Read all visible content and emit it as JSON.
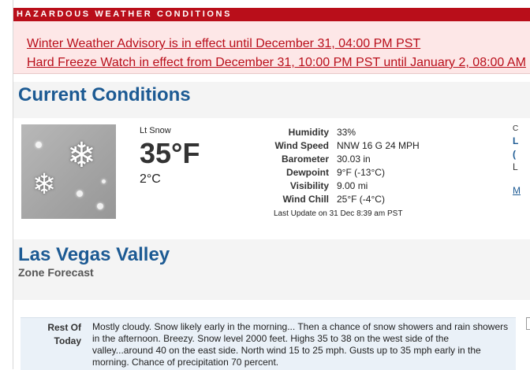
{
  "hazard": {
    "header": "HAZARDOUS WEATHER CONDITIONS",
    "items": [
      "Winter Weather Advisory is in effect until December 31, 04:00 PM PST",
      "Hard Freeze Watch in effect from December 31, 10:00 PM PST until January 2, 08:00 AM"
    ]
  },
  "current": {
    "title": "Current Conditions",
    "condition": "Lt Snow",
    "temp_f": "35°F",
    "temp_c": "2°C",
    "observations": [
      {
        "label": "Humidity",
        "value": "33%"
      },
      {
        "label": "Wind Speed",
        "value": "NNW 16 G 24 MPH"
      },
      {
        "label": "Barometer",
        "value": "30.03 in"
      },
      {
        "label": "Dewpoint",
        "value": "9°F (-13°C)"
      },
      {
        "label": "Visibility",
        "value": "9.00 mi"
      },
      {
        "label": "Wind Chill",
        "value": "25°F (-4°C)"
      }
    ],
    "last_update": "Last Update on 31 Dec 8:39 am PST",
    "right_fragments": [
      "C",
      "L",
      "(",
      "L",
      "M"
    ]
  },
  "zone": {
    "title": "Las Vegas Valley",
    "subtitle": "Zone Forecast"
  },
  "forecast": {
    "period": "Rest Of Today",
    "text": "Mostly cloudy. Snow likely early in the morning... Then a chance of snow showers and rain showers in the afternoon. Breezy. Snow level 2000 feet. Highs 35 to 38 on the west side of the valley...around 40 on the east side. North wind 15 to 25 mph. Gusts up to 35 mph early in the morning. Chance of precipitation 70 percent."
  }
}
